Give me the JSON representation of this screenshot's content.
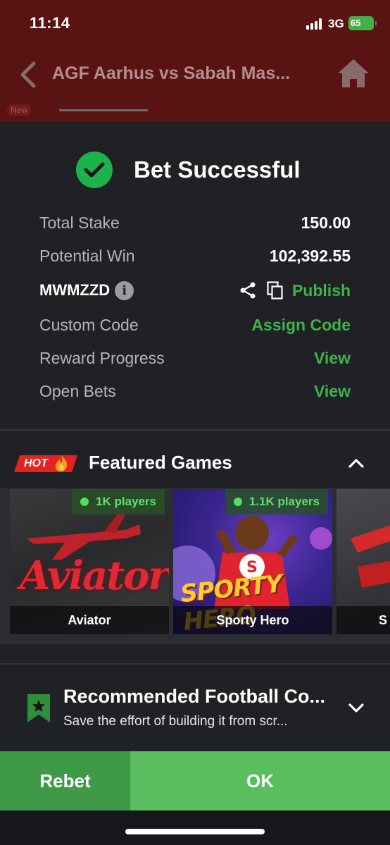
{
  "status_bar": {
    "time": "11:14",
    "network": "3G",
    "battery": "65"
  },
  "header": {
    "title": "AGF Aarhus vs Sabah Mas...",
    "new_badge": "New"
  },
  "bet": {
    "title": "Bet Successful",
    "total_stake_label": "Total Stake",
    "total_stake_value": "150.00",
    "potential_win_label": "Potential Win",
    "potential_win_value": "102,392.55",
    "booking_code": "MWMZZD",
    "info_glyph": "i",
    "publish_label": "Publish",
    "custom_code_label": "Custom Code",
    "assign_code_label": "Assign Code",
    "reward_progress_label": "Reward Progress",
    "reward_view_label": "View",
    "open_bets_label": "Open Bets",
    "open_bets_view_label": "View"
  },
  "featured": {
    "hot_label": "HOT",
    "title": "Featured Games",
    "games": [
      {
        "name": "Aviator",
        "players": "1K players",
        "logo_text": "Aviator"
      },
      {
        "name": "Sporty Hero",
        "players": "1.1K players",
        "logo_text": "SPORTY HERO"
      },
      {
        "name": "S"
      }
    ]
  },
  "recommended": {
    "title": "Recommended Football Co...",
    "subtitle": "Save the effort of building it from scr..."
  },
  "actions": {
    "rebet_label": "Rebet",
    "ok_label": "OK"
  },
  "colors": {
    "accent_green": "#3fb14f",
    "ok_button": "#5abd5e",
    "rebet_button": "#3f9a47",
    "hot_red": "#e3231f",
    "sheet_bg": "#202125"
  },
  "icons": [
    "back-arrow-icon",
    "home-icon",
    "check-icon",
    "info-icon",
    "share-icon",
    "copy-icon",
    "fire-icon",
    "chevron-up-icon",
    "bookmark-star-icon",
    "chevron-down-icon"
  ]
}
